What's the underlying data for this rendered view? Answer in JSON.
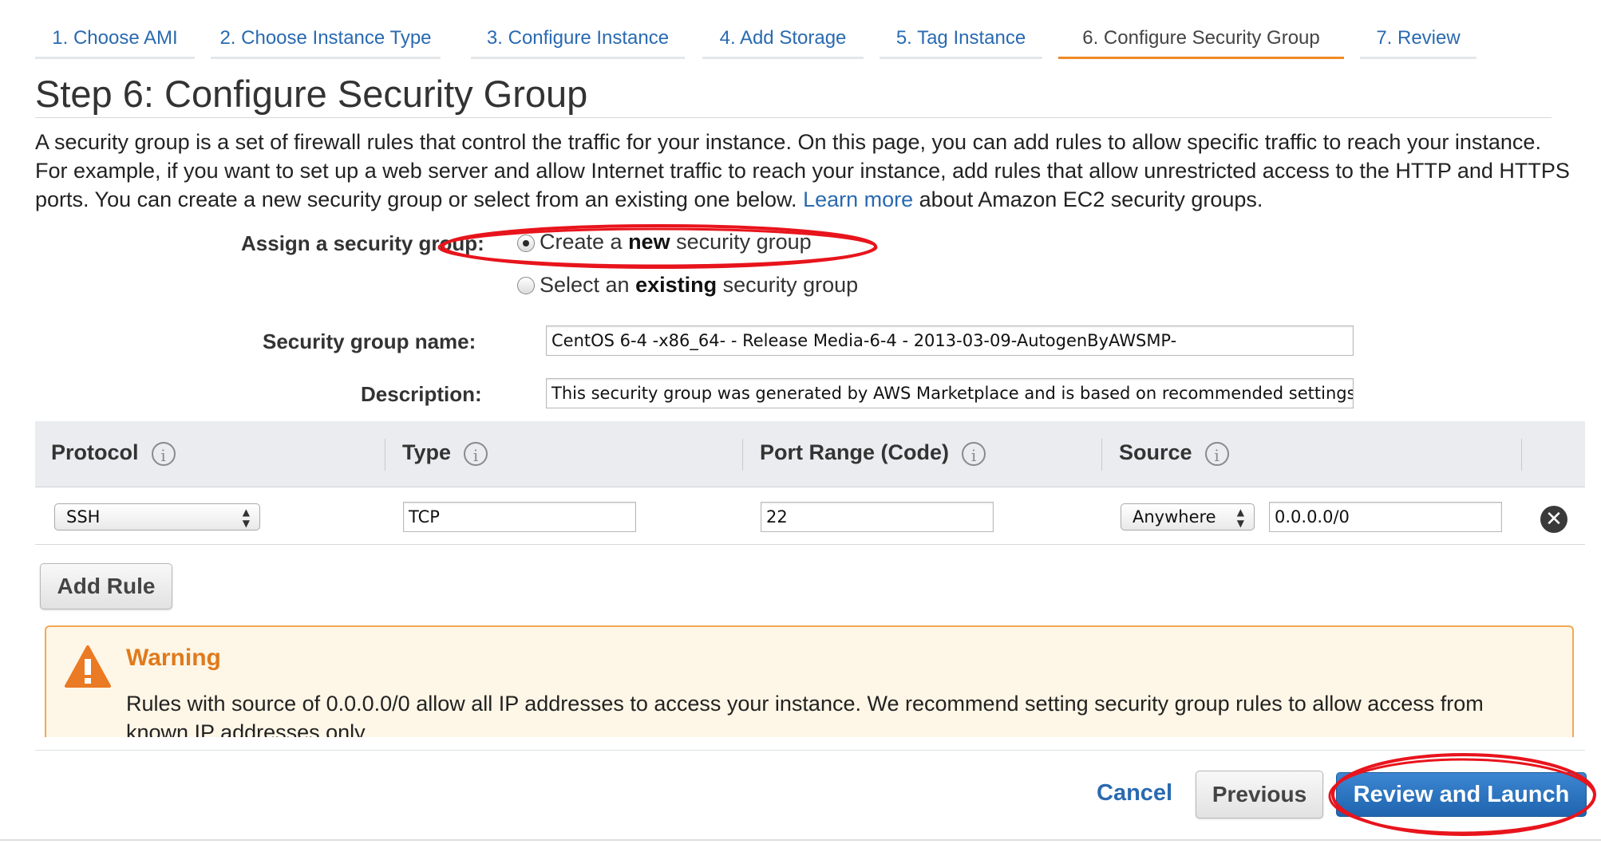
{
  "wizard": {
    "tabs": [
      {
        "label": "1. Choose AMI"
      },
      {
        "label": "2. Choose Instance Type"
      },
      {
        "label": "3. Configure Instance"
      },
      {
        "label": "4. Add Storage"
      },
      {
        "label": "5. Tag Instance"
      },
      {
        "label": "6. Configure Security Group",
        "active": true
      },
      {
        "label": "7. Review"
      }
    ]
  },
  "page": {
    "title": "Step 6: Configure Security Group",
    "intro_text": "A security group is a set of firewall rules that control the traffic for your instance. On this page, you can add rules to allow specific traffic to reach your instance. For example, if you want to set up a web server and allow Internet traffic to reach your instance, add rules that allow unrestricted access to the HTTP and HTTPS ports. You can create a new security group or select from an existing one below.",
    "learn_more": "Learn more",
    "intro_suffix": "about Amazon EC2 security groups."
  },
  "assign": {
    "label": "Assign a security group:",
    "option_new_pre": "Create a ",
    "option_new_bold": "new",
    "option_new_post": " security group",
    "option_existing_pre": "Select an ",
    "option_existing_bold": "existing",
    "option_existing_post": " security group",
    "selected": "new"
  },
  "form": {
    "name_label": "Security group name:",
    "name_value": "CentOS 6-4 -x86_64- - Release Media-6-4 - 2013-03-09-AutogenByAWSMP-",
    "description_label": "Description:",
    "description_value": "This security group was generated by AWS Marketplace and is based on recommended settings"
  },
  "rules_table": {
    "headers": [
      "Protocol",
      "Type",
      "Port Range (Code)",
      "Source"
    ],
    "rows": [
      {
        "protocol": "SSH",
        "type": "TCP",
        "port_range": "22",
        "source_select": "Anywhere",
        "source_cidr": "0.0.0.0/0"
      }
    ]
  },
  "buttons": {
    "add_rule": "Add Rule",
    "cancel": "Cancel",
    "previous": "Previous",
    "review_and_launch": "Review and Launch"
  },
  "warning": {
    "title": "Warning",
    "text": "Rules with source of 0.0.0.0/0 allow all IP addresses to access your instance. We recommend setting security group rules to allow access from known IP addresses only."
  },
  "colors": {
    "link": "#2a6ab0",
    "active_tab_underline": "#f08a24",
    "warning_accent": "#e07a1c",
    "primary_button": "#2a74c4",
    "annotation": "#e8141c"
  }
}
